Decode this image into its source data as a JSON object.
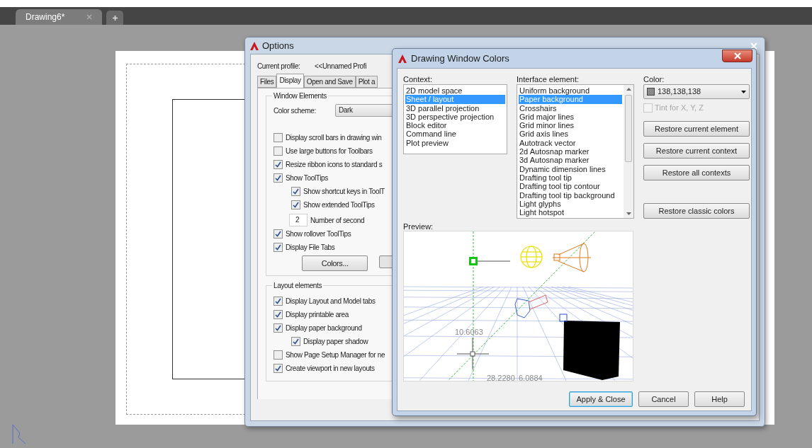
{
  "file_tabs": [
    {
      "label": "Drawing6*",
      "selected": true
    }
  ],
  "options_dialog": {
    "title": "Options",
    "current_profile_label": "Current profile:",
    "current_profile_value": "<<Unnamed Profi",
    "tabs": [
      {
        "label": "Files",
        "selected": false
      },
      {
        "label": "Display",
        "selected": true
      },
      {
        "label": "Open and Save",
        "selected": false
      },
      {
        "label": "Plot a",
        "selected": false
      }
    ],
    "window_elements": {
      "title": "Window Elements",
      "color_scheme_label": "Color scheme:",
      "color_scheme_value": "Dark",
      "items": [
        {
          "kind": "checkbox",
          "label": "Display scroll bars in drawing win",
          "checked": false
        },
        {
          "kind": "checkbox",
          "label": "Use large buttons for Toolbars",
          "checked": false
        },
        {
          "kind": "checkbox",
          "label": "Resize ribbon icons to standard s",
          "checked": true
        },
        {
          "kind": "checkbox",
          "label": "Show ToolTips",
          "checked": true,
          "children": [
            {
              "kind": "checkbox",
              "label": "Show shortcut keys in ToolT",
              "checked": true
            },
            {
              "kind": "checkbox",
              "label": "Show extended ToolTips",
              "checked": true
            },
            {
              "kind": "number",
              "value": "2",
              "label": "Number of second"
            }
          ]
        },
        {
          "kind": "checkbox",
          "label": "Show rollover ToolTips",
          "checked": true
        },
        {
          "kind": "checkbox",
          "label": "Display File Tabs",
          "checked": true
        }
      ],
      "button": "Colors..."
    },
    "layout_elements": {
      "title": "Layout elements",
      "items": [
        {
          "kind": "checkbox",
          "label": "Display Layout and Model tabs",
          "checked": true
        },
        {
          "kind": "checkbox",
          "label": "Display printable area",
          "checked": true
        },
        {
          "kind": "checkbox",
          "label": "Display paper background",
          "checked": true,
          "children": [
            {
              "kind": "checkbox",
              "label": "Display paper shadow",
              "checked": true
            }
          ]
        },
        {
          "kind": "checkbox",
          "label": "Show Page Setup Manager for ne",
          "checked": false
        },
        {
          "kind": "checkbox",
          "label": "Create viewport in new layouts",
          "checked": true
        }
      ]
    }
  },
  "colors_dialog": {
    "title": "Drawing Window Colors",
    "context_label": "Context:",
    "context_items": [
      {
        "label": "2D model space",
        "selected": false
      },
      {
        "label": "Sheet / layout",
        "selected": true
      },
      {
        "label": "3D parallel projection",
        "selected": false
      },
      {
        "label": "3D perspective projection",
        "selected": false
      },
      {
        "label": "Block editor",
        "selected": false
      },
      {
        "label": "Command line",
        "selected": false
      },
      {
        "label": "Plot preview",
        "selected": false
      }
    ],
    "interface_label": "Interface element:",
    "interface_items": [
      {
        "label": "Uniform background",
        "selected": false
      },
      {
        "label": "Paper background",
        "selected": true
      },
      {
        "label": "Crosshairs",
        "selected": false
      },
      {
        "label": "Grid major lines",
        "selected": false
      },
      {
        "label": "Grid minor lines",
        "selected": false
      },
      {
        "label": "Grid axis lines",
        "selected": false
      },
      {
        "label": "Autotrack vector",
        "selected": false
      },
      {
        "label": "2d Autosnap marker",
        "selected": false
      },
      {
        "label": "3d Autosnap marker",
        "selected": false
      },
      {
        "label": "Dynamic dimension lines",
        "selected": false
      },
      {
        "label": "Drafting tool tip",
        "selected": false
      },
      {
        "label": "Drafting tool tip contour",
        "selected": false
      },
      {
        "label": "Drafting tool tip background",
        "selected": false
      },
      {
        "label": "Light glyphs",
        "selected": false
      },
      {
        "label": "Light hotspot",
        "selected": false
      }
    ],
    "color_label": "Color:",
    "color_value": "138,138,138",
    "tint": {
      "label": "Tint for X, Y, Z",
      "checked": false,
      "disabled": true
    },
    "restore_buttons": [
      "Restore current element",
      "Restore current context",
      "Restore all contexts",
      "Restore classic colors"
    ],
    "preview_label": "Preview:",
    "dimension_labels": [
      "10.6063",
      "28.2280",
      "6.0884"
    ],
    "footer_buttons": [
      {
        "label": "Apply & Close",
        "default": true
      },
      {
        "label": "Cancel",
        "default": false
      },
      {
        "label": "Help",
        "default": false
      }
    ]
  }
}
